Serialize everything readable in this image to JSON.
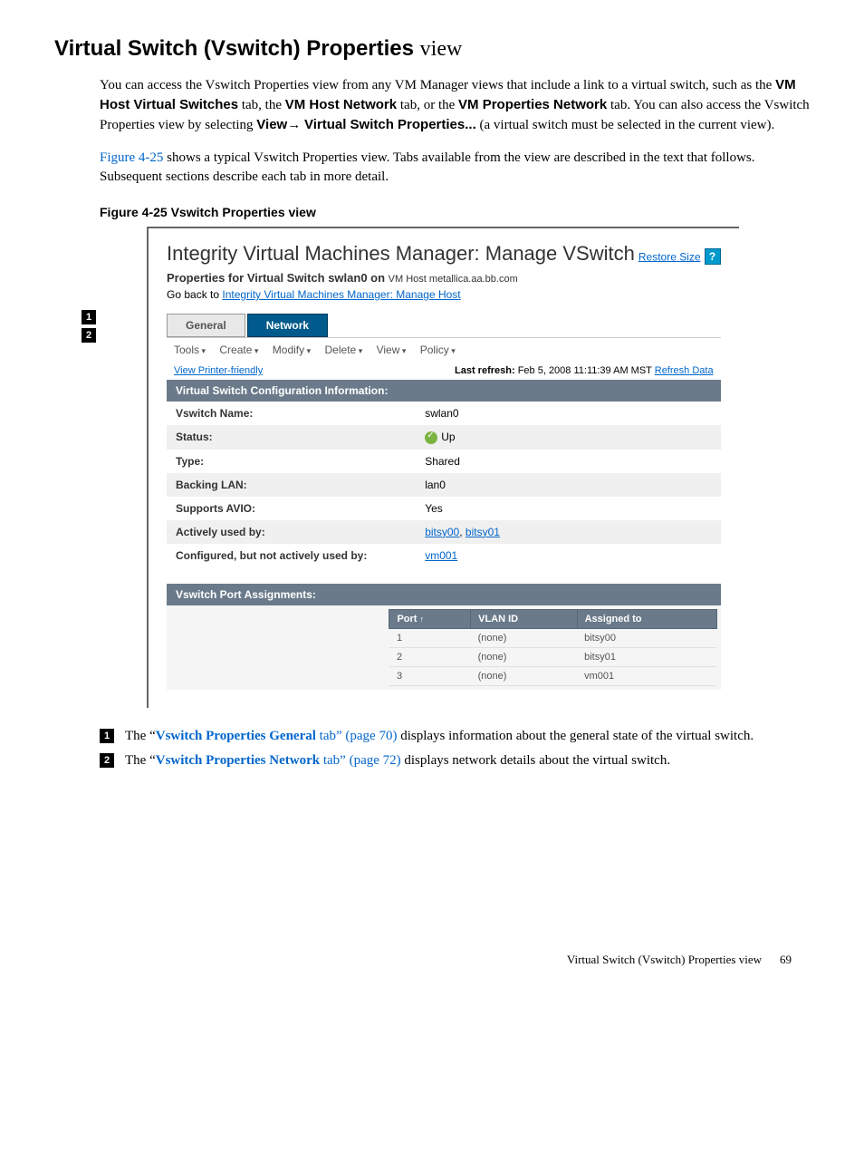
{
  "heading": {
    "title": "Virtual Switch (Vswitch) Properties",
    "suffix": "view"
  },
  "intro": {
    "p1_a": "You can access the Vswitch Properties view from any VM Manager views that include a link to a virtual switch, such as the ",
    "p1_b1": "VM Host Virtual Switches",
    "p1_c": " tab, the ",
    "p1_b2": "VM Host Network",
    "p1_d": " tab, or the ",
    "p1_b3": "VM Properties Network",
    "p1_e": " tab. You can also access the Vswitch Properties view by selecting ",
    "p1_b4": "View",
    "p1_arrow": "→ ",
    "p1_b5": "Virtual Switch Properties...",
    "p1_f": " (a virtual switch must be selected in the current view).",
    "p2_a": "Figure 4-25",
    "p2_b": " shows a typical Vswitch Properties view. Tabs available from the view are described in the text that follows. Subsequent sections describe each tab in more detail."
  },
  "figure": {
    "caption": "Figure 4-25 Vswitch Properties view",
    "title": "Integrity Virtual Machines Manager: Manage VSwitch",
    "restore": "Restore Size",
    "help": "?",
    "properties_label": "Properties for Virtual Switch swlan0 on",
    "host": "VM Host metallica.aa.bb.com",
    "goback_prefix": "Go back to ",
    "goback_link": "Integrity Virtual Machines Manager: Manage Host",
    "tabs": {
      "general": "General",
      "network": "Network"
    },
    "toolbar": {
      "tools": "Tools",
      "create": "Create",
      "modify": "Modify",
      "delete": "Delete",
      "view": "View",
      "policy": "Policy"
    },
    "printer": "View Printer-friendly",
    "last_refresh_label": "Last refresh:",
    "last_refresh_value": "Feb 5, 2008 11:11:39 AM MST",
    "refresh_data": "Refresh Data",
    "section1": "Virtual Switch Configuration Information:",
    "info": {
      "name_l": "Vswitch Name:",
      "name_v": "swlan0",
      "status_l": "Status:",
      "status_v": "Up",
      "type_l": "Type:",
      "type_v": "Shared",
      "backing_l": "Backing LAN:",
      "backing_v": "lan0",
      "avio_l": "Supports AVIO:",
      "avio_v": "Yes",
      "active_l": "Actively used by:",
      "active_v1": "bitsy00",
      "active_sep": ", ",
      "active_v2": "bitsy01",
      "config_l": "Configured, but not actively used by:",
      "config_v": "vm001"
    },
    "section2": "Vswitch Port Assignments:",
    "port_headers": {
      "port": "Port",
      "vlan": "VLAN ID",
      "assigned": "Assigned to"
    },
    "ports": [
      {
        "port": "1",
        "vlan": "(none)",
        "assigned": "bitsy00"
      },
      {
        "port": "2",
        "vlan": "(none)",
        "assigned": "bitsy01"
      },
      {
        "port": "3",
        "vlan": "(none)",
        "assigned": "vm001"
      }
    ]
  },
  "callouts": {
    "c1": {
      "num": "1",
      "a": "The “",
      "link": "Vswitch Properties General",
      "b": " tab” (page 70)",
      "c": " displays information about the general state of the virtual switch."
    },
    "c2": {
      "num": "2",
      "a": "The “",
      "link": "Vswitch Properties Network",
      "b": " tab” (page 72)",
      "c": " displays network details about the virtual switch."
    }
  },
  "footer": {
    "label": "Virtual Switch (Vswitch) Properties view",
    "page": "69"
  }
}
